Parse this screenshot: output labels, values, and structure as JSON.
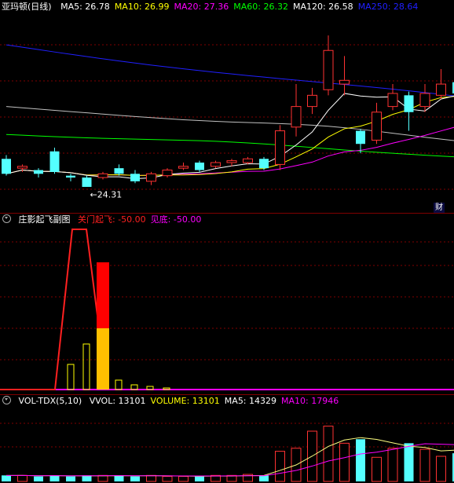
{
  "main": {
    "title": "亚玛顿(日线)",
    "ma": [
      {
        "label": "MA5: 26.78",
        "color": "#ffffff"
      },
      {
        "label": "MA10: 26.99",
        "color": "#ffff00"
      },
      {
        "label": "MA20: 27.36",
        "color": "#ff00ff"
      },
      {
        "label": "MA60: 26.32",
        "color": "#00ff00"
      },
      {
        "label": "MA120: 26.58",
        "color": "#ffffff"
      },
      {
        "label": "MA250: 28.64",
        "color": "#2020ff"
      }
    ],
    "low_label": "←24.31",
    "cai_badge": "财",
    "candles": [
      {
        "o": 25.8,
        "c": 25.0,
        "h": 26.0,
        "l": 24.9,
        "up": false
      },
      {
        "o": 25.3,
        "c": 25.4,
        "h": 25.5,
        "l": 25.1,
        "up": true
      },
      {
        "o": 25.2,
        "c": 25.0,
        "h": 25.3,
        "l": 24.8,
        "up": false
      },
      {
        "o": 26.2,
        "c": 25.1,
        "h": 26.4,
        "l": 25.0,
        "up": false
      },
      {
        "o": 24.9,
        "c": 24.8,
        "h": 25.0,
        "l": 24.6,
        "up": false
      },
      {
        "o": 24.8,
        "c": 24.3,
        "h": 24.9,
        "l": 24.31,
        "up": false
      },
      {
        "o": 24.8,
        "c": 25.0,
        "h": 25.1,
        "l": 24.7,
        "up": true
      },
      {
        "o": 25.3,
        "c": 25.0,
        "h": 25.5,
        "l": 24.9,
        "up": false
      },
      {
        "o": 25.0,
        "c": 24.6,
        "h": 25.2,
        "l": 24.5,
        "up": false
      },
      {
        "o": 24.6,
        "c": 25.0,
        "h": 25.1,
        "l": 24.4,
        "up": true
      },
      {
        "o": 24.9,
        "c": 25.2,
        "h": 25.3,
        "l": 24.8,
        "up": true
      },
      {
        "o": 25.3,
        "c": 25.4,
        "h": 25.6,
        "l": 25.2,
        "up": true
      },
      {
        "o": 25.6,
        "c": 25.2,
        "h": 25.7,
        "l": 25.1,
        "up": false
      },
      {
        "o": 25.4,
        "c": 25.6,
        "h": 25.7,
        "l": 25.3,
        "up": true
      },
      {
        "o": 25.6,
        "c": 25.7,
        "h": 25.8,
        "l": 25.4,
        "up": true
      },
      {
        "o": 25.6,
        "c": 25.8,
        "h": 25.9,
        "l": 25.5,
        "up": true
      },
      {
        "o": 25.8,
        "c": 25.3,
        "h": 25.9,
        "l": 25.2,
        "up": false
      },
      {
        "o": 25.5,
        "c": 27.3,
        "h": 27.6,
        "l": 25.2,
        "up": true
      },
      {
        "o": 27.5,
        "c": 28.6,
        "h": 29.8,
        "l": 27.0,
        "up": true
      },
      {
        "o": 28.6,
        "c": 29.2,
        "h": 29.6,
        "l": 28.2,
        "up": true
      },
      {
        "o": 29.5,
        "c": 31.6,
        "h": 32.4,
        "l": 29.2,
        "up": true
      },
      {
        "o": 30.0,
        "c": 29.8,
        "h": 31.3,
        "l": 29.2,
        "up": true
      },
      {
        "o": 27.3,
        "c": 26.6,
        "h": 27.4,
        "l": 26.1,
        "up": false
      },
      {
        "o": 26.8,
        "c": 28.3,
        "h": 28.8,
        "l": 26.6,
        "up": true
      },
      {
        "o": 28.6,
        "c": 29.3,
        "h": 29.8,
        "l": 28.4,
        "up": true
      },
      {
        "o": 29.2,
        "c": 28.3,
        "h": 29.4,
        "l": 27.3,
        "up": false
      },
      {
        "o": 28.6,
        "c": 29.3,
        "h": 29.8,
        "l": 28.3,
        "up": true
      },
      {
        "o": 29.2,
        "c": 29.8,
        "h": 30.6,
        "l": 29.0,
        "up": true
      },
      {
        "o": 29.9,
        "c": 29.3,
        "h": 30.6,
        "l": 29.1,
        "up": false
      }
    ]
  },
  "zhuang": {
    "title": "庄影起飞副图",
    "labels": [
      {
        "text": "关门起飞: -50.00",
        "color": "#ff2020"
      },
      {
        "text": "见底: -50.00",
        "color": "#ff00ff"
      }
    ]
  },
  "volume": {
    "title": "VOL-TDX(5,10)",
    "labels": [
      {
        "text": "VVOL: 13101",
        "color": "#ffffff"
      },
      {
        "text": "VOLUME: 13101",
        "color": "#ffff00"
      },
      {
        "text": "MA5: 14329",
        "color": "#ffffff"
      },
      {
        "text": "MA10: 17946",
        "color": "#ff00ff"
      }
    ],
    "bars": [
      {
        "v": 6,
        "up": false
      },
      {
        "v": 6,
        "up": true
      },
      {
        "v": 5,
        "up": false
      },
      {
        "v": 6,
        "up": false
      },
      {
        "v": 5,
        "up": false
      },
      {
        "v": 6,
        "up": false
      },
      {
        "v": 6,
        "up": true
      },
      {
        "v": 6,
        "up": false
      },
      {
        "v": 5,
        "up": false
      },
      {
        "v": 6,
        "up": true
      },
      {
        "v": 5,
        "up": true
      },
      {
        "v": 5,
        "up": true
      },
      {
        "v": 5,
        "up": false
      },
      {
        "v": 6,
        "up": true
      },
      {
        "v": 6,
        "up": true
      },
      {
        "v": 7,
        "up": true
      },
      {
        "v": 6,
        "up": false
      },
      {
        "v": 30,
        "up": true
      },
      {
        "v": 33,
        "up": true
      },
      {
        "v": 50,
        "up": true
      },
      {
        "v": 55,
        "up": true
      },
      {
        "v": 38,
        "up": true
      },
      {
        "v": 42,
        "up": false
      },
      {
        "v": 24,
        "up": true
      },
      {
        "v": 33,
        "up": true
      },
      {
        "v": 38,
        "up": false
      },
      {
        "v": 32,
        "up": true
      },
      {
        "v": 25,
        "up": true
      },
      {
        "v": 28,
        "up": false
      }
    ]
  }
}
